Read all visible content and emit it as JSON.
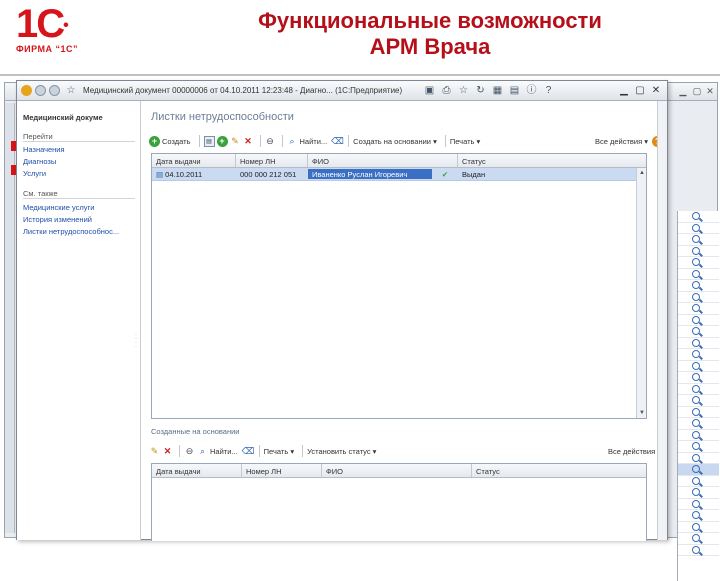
{
  "slide": {
    "title_line1": "Функциональные возможности",
    "title_line2": "АРМ Врача",
    "logo_mark": "1С",
    "logo_sub": "ФИРМА “1С”"
  },
  "window": {
    "title": "Медицинский документ 00000006 от 04.10.2011 12:23:48 - Диагно... (1С:Предприятие)",
    "icons": [
      "app-icon",
      "back-icon",
      "forward-icon",
      "star-icon",
      "save-icon",
      "print-icon",
      "calc-icon",
      "calendar-icon",
      "minimize-icon",
      "restore-icon",
      "close-icon"
    ]
  },
  "sidebar": {
    "title": "Медицинский докуме",
    "section1": "Перейти",
    "section1_items": [
      "Назначения",
      "Диагнозы",
      "Услуги"
    ],
    "section2": "См. также",
    "section2_items": [
      "Медицинские услуги",
      "История изменений",
      "Листки нетрудоспособнос..."
    ]
  },
  "main": {
    "title": "Листки нетрудоспособности",
    "toolbar": {
      "create": "Создать",
      "find": "Найти...",
      "create_based": "Создать на основании",
      "print": "Печать",
      "all_actions": "Все действия"
    },
    "columns": [
      "Дата выдачи",
      "Номер ЛН",
      "ФИО",
      "Статус"
    ],
    "rows": [
      {
        "date": "04.10.2011",
        "number": "000 000 212 051",
        "fio": "Иваненко Руслан Игоревич",
        "status": "Выдан"
      }
    ]
  },
  "secondary": {
    "title": "Созданные на основании",
    "toolbar": {
      "find": "Найти...",
      "print": "Печать",
      "set_status": "Установить статус",
      "all_actions": "Все действия"
    },
    "columns": [
      "Дата выдачи",
      "Номер ЛН",
      "ФИО",
      "Статус"
    ]
  },
  "colors": {
    "brand_red": "#d7141a",
    "selection": "#3a6fc4",
    "row_highlight": "#c9daf1",
    "link": "#1f4ea8"
  }
}
